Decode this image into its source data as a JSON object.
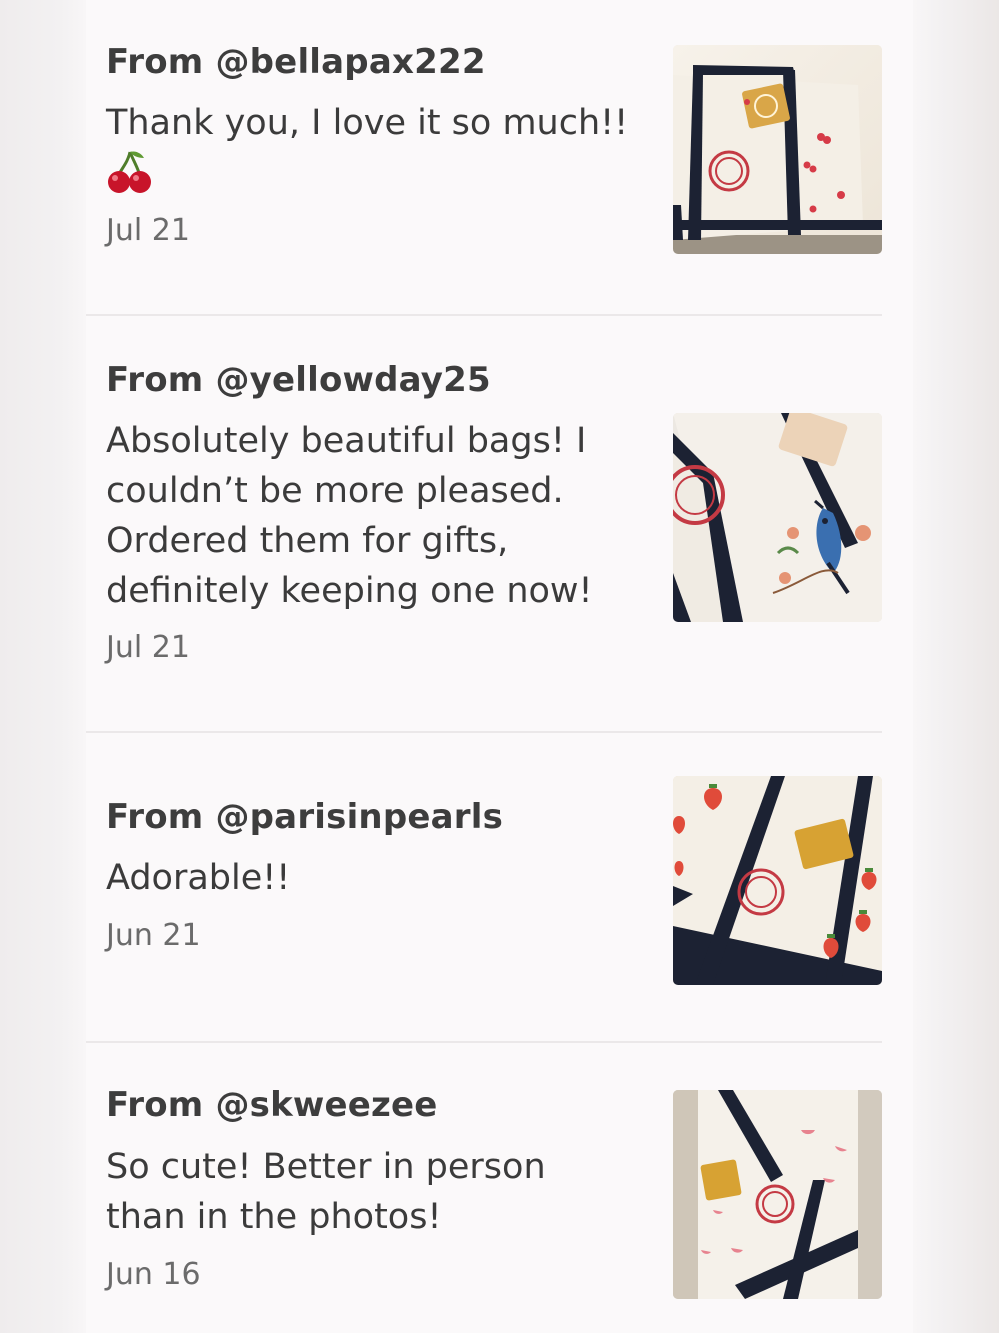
{
  "reviews": [
    {
      "from": "From @bellapax222",
      "text": "Thank you, I love it so much!!",
      "emoji": "cherry-icon",
      "date": "Jul 21",
      "photo": "tote-bag-cherries"
    },
    {
      "from": "From @yellowday25",
      "text": "Absolutely beautiful bags! I couldn’t be more pleased. Ordered them for gifts, definitely keeping one now!",
      "date": "Jul 21",
      "photo": "tote-bag-bird"
    },
    {
      "from": "From @parisinpearls",
      "text": "Adorable!!",
      "date": "Jun 21",
      "photo": "tote-bag-strawberries"
    },
    {
      "from": "From @skweezee",
      "text": "So cute! Better in person than in the photos!",
      "date": "Jun 16",
      "photo": "tote-bag-watermelon"
    }
  ],
  "colors": {
    "navy": "#1c2233",
    "canvas": "#f2ece2",
    "logo_red": "#c43a44",
    "tag_gold": "#d9a648"
  }
}
